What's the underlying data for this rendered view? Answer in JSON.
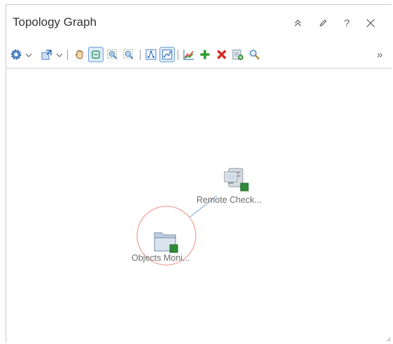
{
  "panel": {
    "title": "Topology Graph"
  },
  "toolbar": {
    "items": [
      "settings-gear-icon",
      "chevron-down-icon",
      "layout-export-icon",
      "chevron-down-icon",
      "pan-hand-icon",
      "select-icon",
      "zoom-in-icon",
      "zoom-out-icon",
      "tree-layout-icon",
      "graph-layout-icon",
      "chart-icon",
      "add-icon",
      "delete-icon",
      "properties-icon",
      "search-icon",
      "more-icon"
    ],
    "overflow_label": "»",
    "accent": "#4a90d9"
  },
  "graph": {
    "nodes": [
      {
        "label": "Remote Check...",
        "icon": "server-icon",
        "status_color": "#2e8b3a"
      },
      {
        "label": "Objects Moni...",
        "icon": "folder-icon",
        "status_color": "#2e8b3a",
        "selected": true
      }
    ],
    "edge_color": "#8fb4dd",
    "selection_color": "#f2a39d"
  }
}
